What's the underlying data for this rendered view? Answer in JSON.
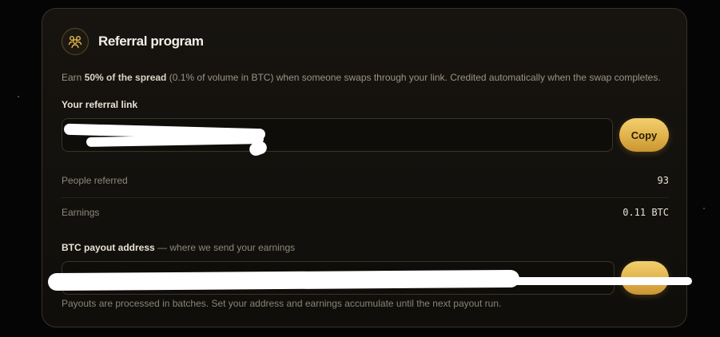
{
  "card": {
    "title": "Referral program",
    "icon": "people-group-icon",
    "accent_color": "#e6b84f"
  },
  "description": {
    "prefix": "Earn ",
    "emphasis": "50% of the spread",
    "suffix": " (0.1% of volume in BTC) when someone swaps through your link. Credited automatically when the swap completes."
  },
  "referral_link": {
    "label": "Your referral link",
    "copy_label": "Copy"
  },
  "stats": [
    {
      "label": "People referred",
      "value": "93"
    },
    {
      "label": "Earnings",
      "value": "0.11 BTC"
    }
  ],
  "payout": {
    "label": "BTC payout address",
    "sublabel": " — where we send your earnings",
    "footnote": "Payouts are processed in batches. Set your address and earnings accumulate until the next payout run."
  }
}
